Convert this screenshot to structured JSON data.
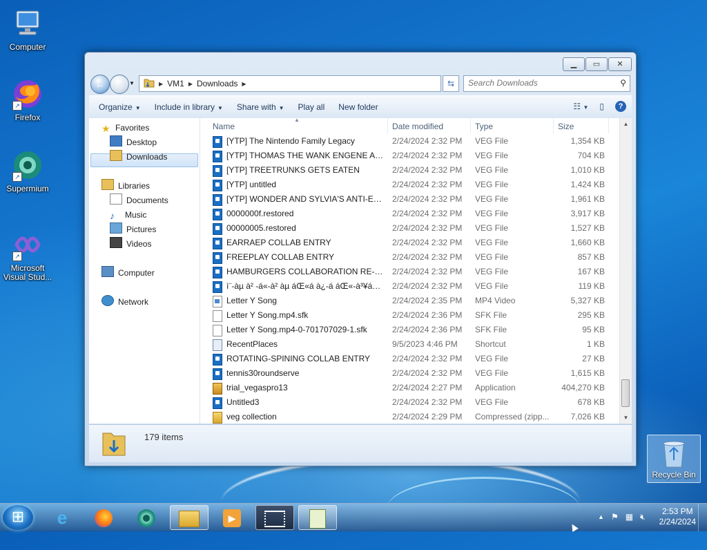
{
  "desktop": {
    "icons": [
      {
        "label": "Computer"
      },
      {
        "label": "Firefox"
      },
      {
        "label": "Supermium"
      },
      {
        "label": "Microsoft Visual Stud..."
      }
    ],
    "recycle_bin": "Recycle Bin"
  },
  "window": {
    "address": [
      "VM1",
      "Downloads"
    ],
    "search_placeholder": "Search Downloads",
    "toolbar": {
      "organize": "Organize",
      "include": "Include in library",
      "share": "Share with",
      "play": "Play all",
      "newfolder": "New folder"
    },
    "nav": {
      "favorites": "Favorites",
      "desktop": "Desktop",
      "downloads": "Downloads",
      "libraries": "Libraries",
      "documents": "Documents",
      "music": "Music",
      "pictures": "Pictures",
      "videos": "Videos",
      "computer": "Computer",
      "network": "Network"
    },
    "columns": {
      "name": "Name",
      "date": "Date modified",
      "type": "Type",
      "size": "Size"
    },
    "files": [
      {
        "name": "[YTP] The Nintendo Family Legacy",
        "date": "2/24/2024 2:32 PM",
        "type": "VEG File",
        "size": "1,354 KB",
        "icon": "veg"
      },
      {
        "name": "[YTP] THOMAS THE WANK ENGENE AN...",
        "date": "2/24/2024 2:32 PM",
        "type": "VEG File",
        "size": "704 KB",
        "icon": "veg"
      },
      {
        "name": "[YTP] TREETRUNKS GETS EATEN",
        "date": "2/24/2024 2:32 PM",
        "type": "VEG File",
        "size": "1,010 KB",
        "icon": "veg"
      },
      {
        "name": "[YTP] untitled",
        "date": "2/24/2024 2:32 PM",
        "type": "VEG File",
        "size": "1,424 KB",
        "icon": "veg"
      },
      {
        "name": "[YTP] WONDER AND SYLVIA'S ANTI-EAR...",
        "date": "2/24/2024 2:32 PM",
        "type": "VEG File",
        "size": "1,961 KB",
        "icon": "veg"
      },
      {
        "name": "0000000f.restored",
        "date": "2/24/2024 2:32 PM",
        "type": "VEG File",
        "size": "3,917 KB",
        "icon": "veg"
      },
      {
        "name": "00000005.restored",
        "date": "2/24/2024 2:32 PM",
        "type": "VEG File",
        "size": "1,527 KB",
        "icon": "veg"
      },
      {
        "name": "EARRAEP COLLAB ENTRY",
        "date": "2/24/2024 2:32 PM",
        "type": "VEG File",
        "size": "1,660 KB",
        "icon": "veg"
      },
      {
        "name": "FREEPLAY COLLAB ENTRY",
        "date": "2/24/2024 2:32 PM",
        "type": "VEG File",
        "size": "857 KB",
        "icon": "veg"
      },
      {
        "name": "HAMBURGERS COLLABORATION RE-EN...",
        "date": "2/24/2024 2:32 PM",
        "type": "VEG File",
        "size": "167 KB",
        "icon": "veg"
      },
      {
        "name": "ì¨-àµ à² -á«-à² àµ áŒ«á à¿-á áŒ«-à³¥áµá...",
        "date": "2/24/2024 2:32 PM",
        "type": "VEG File",
        "size": "119 KB",
        "icon": "veg"
      },
      {
        "name": "Letter Y Song",
        "date": "2/24/2024 2:35 PM",
        "type": "MP4 Video",
        "size": "5,327 KB",
        "icon": "mp4"
      },
      {
        "name": "Letter Y Song.mp4.sfk",
        "date": "2/24/2024 2:36 PM",
        "type": "SFK File",
        "size": "295 KB",
        "icon": "doc"
      },
      {
        "name": "Letter Y Song.mp4-0-701707029-1.sfk",
        "date": "2/24/2024 2:36 PM",
        "type": "SFK File",
        "size": "95 KB",
        "icon": "doc"
      },
      {
        "name": "RecentPlaces",
        "date": "9/5/2023 4:46 PM",
        "type": "Shortcut",
        "size": "1 KB",
        "icon": "lnk"
      },
      {
        "name": "ROTATING-SPINING COLLAB ENTRY",
        "date": "2/24/2024 2:32 PM",
        "type": "VEG File",
        "size": "27 KB",
        "icon": "veg"
      },
      {
        "name": "tennis30roundserve",
        "date": "2/24/2024 2:32 PM",
        "type": "VEG File",
        "size": "1,615 KB",
        "icon": "veg"
      },
      {
        "name": "trial_vegaspro13",
        "date": "2/24/2024 2:27 PM",
        "type": "Application",
        "size": "404,270 KB",
        "icon": "app"
      },
      {
        "name": "Untitled3",
        "date": "2/24/2024 2:32 PM",
        "type": "VEG File",
        "size": "678 KB",
        "icon": "veg"
      },
      {
        "name": "veg collection",
        "date": "2/24/2024 2:29 PM",
        "type": "Compressed (zipp...",
        "size": "7,026 KB",
        "icon": "zip"
      }
    ],
    "status": "179 items"
  },
  "taskbar": {
    "time": "2:53 PM",
    "date": "2/24/2024"
  }
}
